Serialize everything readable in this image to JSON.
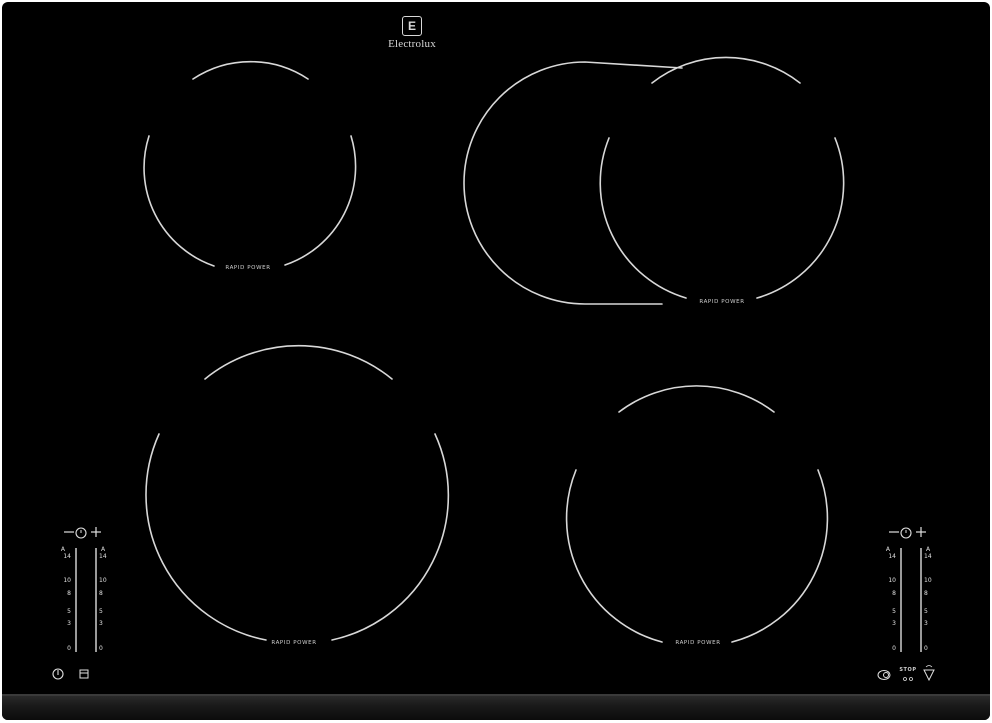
{
  "brand": {
    "name": "Electrolux",
    "icon": "electrolux-logo-icon"
  },
  "zones": [
    {
      "id": "rear-left",
      "label": "RAPID POWER"
    },
    {
      "id": "rear-right",
      "label": "RAPID POWER"
    },
    {
      "id": "front-left",
      "label": "RAPID POWER"
    },
    {
      "id": "front-right",
      "label": "RAPID POWER"
    }
  ],
  "controls": {
    "minus": "−",
    "plus": "+",
    "scale_top": "A",
    "scale_numbers": [
      "14",
      "10",
      "8",
      "5",
      "3",
      "0"
    ],
    "stop_label": "STOP",
    "icons": {
      "power": "power-icon",
      "lock": "lock-icon",
      "timer": "timer-icon",
      "bridge": "bridge-icon",
      "stop_go": "stop-go-icon",
      "hob2hood": "hob2hood-icon"
    }
  },
  "colors": {
    "glass": "#000000",
    "lines": "#d8d8d8"
  }
}
